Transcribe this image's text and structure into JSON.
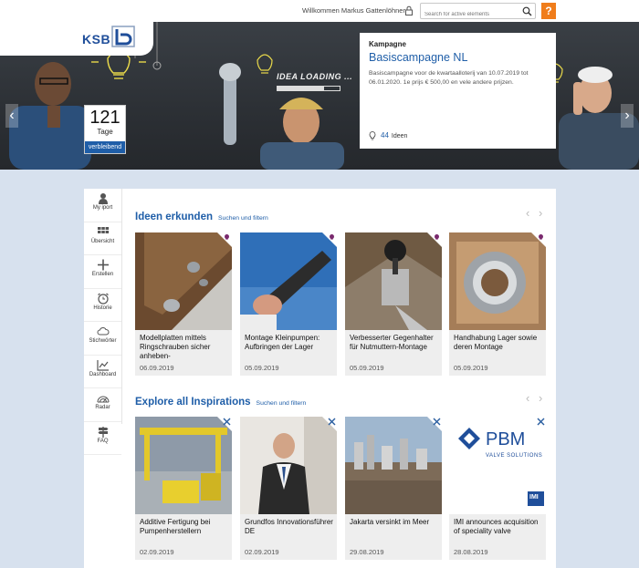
{
  "header": {
    "welcome": "Willkommen Markus Gattenlöhner",
    "search_placeholder": "Search for active elements",
    "help_label": "?"
  },
  "brand": {
    "logo_text": "KSB",
    "accent": "#1f5ea8",
    "orange": "#f07d1b"
  },
  "hero": {
    "overlay_text": "IDEA LOADING ...",
    "counter": {
      "value": "121",
      "unit": "Tage",
      "label": "verbleibend"
    },
    "campaign": {
      "kicker": "Kampagne",
      "title": "Basiscampagne NL",
      "description": "Basiscampagne voor de kwartaalloterij van 10.07.2019 tot 06.01.2020. 1e prijs € 500,00 en vele andere prijzen.",
      "ideas_count": "44",
      "ideas_label": "Ideen"
    },
    "prev_label": "‹",
    "next_label": "›"
  },
  "sidenav": {
    "items": [
      {
        "label": "My iport",
        "icon": "user-icon"
      },
      {
        "label": "Übersicht",
        "icon": "grid-icon"
      },
      {
        "label": "Erstellen",
        "icon": "plus-icon"
      },
      {
        "label": "Historie",
        "icon": "alarm-clock-icon"
      },
      {
        "label": "Stichwörter",
        "icon": "cloud-icon"
      },
      {
        "label": "Dashboard",
        "icon": "chart-icon"
      },
      {
        "label": "Radar",
        "icon": "radar-icon"
      },
      {
        "label": "FAQ",
        "icon": "signpost-icon"
      }
    ]
  },
  "ideas_section": {
    "title": "Ideen erkunden",
    "link": "Suchen und filtern",
    "prev": "‹",
    "next": "›",
    "cards": [
      {
        "title": "Modellplatten mittels Ringschrauben sicher anheben-",
        "date": "06.09.2019",
        "icon": "lightbulb-icon"
      },
      {
        "title": "Montage Kleinpumpen: Aufbringen der Lager",
        "date": "05.09.2019",
        "icon": "lightbulb-icon"
      },
      {
        "title": "Verbesserter Gegenhalter für Nutmuttern-Montage",
        "date": "05.09.2019",
        "icon": "lightbulb-icon"
      },
      {
        "title": "Handhabung Lager sowie deren Montage",
        "date": "05.09.2019",
        "icon": "lightbulb-icon"
      }
    ]
  },
  "inspirations_section": {
    "title": "Explore all Inspirations",
    "link": "Suchen und filtern",
    "prev": "‹",
    "next": "›",
    "cards": [
      {
        "title": "Additive Fertigung bei Pumpenherstellern",
        "date": "02.09.2019",
        "icon": "tools-icon"
      },
      {
        "title": "Grundfos Innovationsführer DE",
        "date": "02.09.2019",
        "icon": "tools-icon"
      },
      {
        "title": "Jakarta versinkt im Meer",
        "date": "29.08.2019",
        "icon": "tools-icon"
      },
      {
        "title": "IMI announces acquisition of speciality valve",
        "date": "28.08.2019",
        "icon": "tools-icon",
        "logo_text": "PBM",
        "logo_sub": "VALVE SOLUTIONS",
        "badge": "IMI"
      }
    ]
  }
}
